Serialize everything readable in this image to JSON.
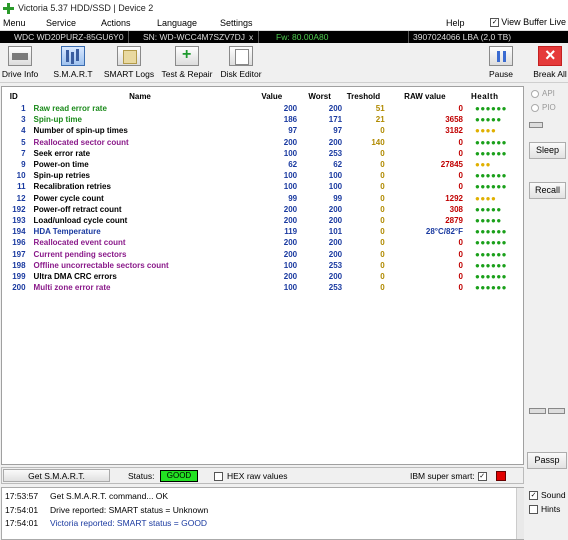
{
  "window": {
    "title": "Victoria 5.37 HDD/SSD | Device 2"
  },
  "menu": {
    "items": [
      "Menu",
      "Service",
      "Actions",
      "Language",
      "Settings",
      "Help"
    ],
    "view_buffer_label": "View Buffer Live",
    "view_buffer_checked": true
  },
  "device": {
    "model": "WDC WD20PURZ-85GU6Y0",
    "serial": "SN: WD-WCC4M7SZV7DJ",
    "close_glyph": "x",
    "firmware": "Fw: 80.00A80",
    "capacity": "3907024066 LBA (2,0 TB)"
  },
  "toolbar": {
    "drive_info": "Drive Info",
    "smart": "S.M.A.R.T",
    "smart_logs": "SMART Logs",
    "test_repair": "Test & Repair",
    "disk_editor": "Disk Editor",
    "pause": "Pause",
    "break_all": "Break All"
  },
  "table": {
    "headers": {
      "id": "ID",
      "name": "Name",
      "value": "Value",
      "worst": "Worst",
      "threshold": "Treshold",
      "raw": "RAW value",
      "health": "Health"
    },
    "rows": [
      {
        "id": "1",
        "name": "Raw read error rate",
        "value": "200",
        "worst": "200",
        "thr": "51",
        "raw": "0",
        "health": "●●●●●●",
        "color": "#1a8a1a",
        "raw_color": "#c00000",
        "thr_color": "#b08a00",
        "health_color": "#1aa01a"
      },
      {
        "id": "3",
        "name": "Spin-up time",
        "value": "186",
        "worst": "171",
        "thr": "21",
        "raw": "3658",
        "health": "●●●●●",
        "color": "#1a8a1a",
        "raw_color": "#c00000",
        "thr_color": "#b08a00",
        "health_color": "#1aa01a"
      },
      {
        "id": "4",
        "name": "Number of spin-up times",
        "value": "97",
        "worst": "97",
        "thr": "0",
        "raw": "3182",
        "health": "●●●●",
        "color": "#000000",
        "raw_color": "#c00000",
        "thr_color": "#b08a00",
        "health_color": "#e0b000"
      },
      {
        "id": "5",
        "name": "Reallocated sector count",
        "value": "200",
        "worst": "200",
        "thr": "140",
        "raw": "0",
        "health": "●●●●●●",
        "color": "#8a1a8a",
        "raw_color": "#c00000",
        "thr_color": "#b08a00",
        "health_color": "#1aa01a"
      },
      {
        "id": "7",
        "name": "Seek error rate",
        "value": "100",
        "worst": "253",
        "thr": "0",
        "raw": "0",
        "health": "●●●●●●",
        "color": "#000000",
        "raw_color": "#c00000",
        "thr_color": "#b08a00",
        "health_color": "#1aa01a"
      },
      {
        "id": "9",
        "name": "Power-on time",
        "value": "62",
        "worst": "62",
        "thr": "0",
        "raw": "27845",
        "health": "●●●",
        "color": "#000000",
        "raw_color": "#c00000",
        "thr_color": "#b08a00",
        "health_color": "#e0b000"
      },
      {
        "id": "10",
        "name": "Spin-up retries",
        "value": "100",
        "worst": "100",
        "thr": "0",
        "raw": "0",
        "health": "●●●●●●",
        "color": "#000000",
        "raw_color": "#c00000",
        "thr_color": "#b08a00",
        "health_color": "#1aa01a"
      },
      {
        "id": "11",
        "name": "Recalibration retries",
        "value": "100",
        "worst": "100",
        "thr": "0",
        "raw": "0",
        "health": "●●●●●●",
        "color": "#000000",
        "raw_color": "#c00000",
        "thr_color": "#b08a00",
        "health_color": "#1aa01a"
      },
      {
        "id": "12",
        "name": "Power cycle count",
        "value": "99",
        "worst": "99",
        "thr": "0",
        "raw": "1292",
        "health": "●●●●",
        "color": "#000000",
        "raw_color": "#c00000",
        "thr_color": "#b08a00",
        "health_color": "#e0b000"
      },
      {
        "id": "192",
        "name": "Power-off retract count",
        "value": "200",
        "worst": "200",
        "thr": "0",
        "raw": "308",
        "health": "●●●●●",
        "color": "#000000",
        "raw_color": "#c00000",
        "thr_color": "#b08a00",
        "health_color": "#1aa01a"
      },
      {
        "id": "193",
        "name": "Load/unload cycle count",
        "value": "200",
        "worst": "200",
        "thr": "0",
        "raw": "2879",
        "health": "●●●●●",
        "color": "#000000",
        "raw_color": "#c00000",
        "thr_color": "#b08a00",
        "health_color": "#1aa01a"
      },
      {
        "id": "194",
        "name": "HDA Temperature",
        "value": "119",
        "worst": "101",
        "thr": "0",
        "raw": "28°C/82°F",
        "health": "●●●●●●",
        "color": "#1a3aa0",
        "raw_color": "#1a3aa0",
        "thr_color": "#b08a00",
        "health_color": "#1aa01a"
      },
      {
        "id": "196",
        "name": "Reallocated event count",
        "value": "200",
        "worst": "200",
        "thr": "0",
        "raw": "0",
        "health": "●●●●●●",
        "color": "#8a1a8a",
        "raw_color": "#c00000",
        "thr_color": "#b08a00",
        "health_color": "#1aa01a"
      },
      {
        "id": "197",
        "name": "Current pending sectors",
        "value": "200",
        "worst": "200",
        "thr": "0",
        "raw": "0",
        "health": "●●●●●●",
        "color": "#8a1a8a",
        "raw_color": "#c00000",
        "thr_color": "#b08a00",
        "health_color": "#1aa01a"
      },
      {
        "id": "198",
        "name": "Offline uncorrectable sectors count",
        "value": "100",
        "worst": "253",
        "thr": "0",
        "raw": "0",
        "health": "●●●●●●",
        "color": "#8a1a8a",
        "raw_color": "#c00000",
        "thr_color": "#b08a00",
        "health_color": "#1aa01a"
      },
      {
        "id": "199",
        "name": "Ultra DMA CRC errors",
        "value": "200",
        "worst": "200",
        "thr": "0",
        "raw": "0",
        "health": "●●●●●●",
        "color": "#000000",
        "raw_color": "#c00000",
        "thr_color": "#b08a00",
        "health_color": "#1aa01a"
      },
      {
        "id": "200",
        "name": "Multi zone error rate",
        "value": "100",
        "worst": "253",
        "thr": "0",
        "raw": "0",
        "health": "●●●●●●",
        "color": "#8a1a8a",
        "raw_color": "#c00000",
        "thr_color": "#b08a00",
        "health_color": "#1aa01a"
      }
    ]
  },
  "right_panel": {
    "api": "API",
    "pio": "PIO",
    "sleep": "Sleep",
    "recall": "Recall",
    "passp": "Passp"
  },
  "status": {
    "get_smart": "Get S.M.A.R.T.",
    "status_label": "Status:",
    "status_value": "GOOD",
    "hex_raw": "HEX raw values",
    "ibm_label": "IBM super smart:",
    "ibm_checked": true
  },
  "log": [
    {
      "time": "17:53:57",
      "text": "Get S.M.A.R.T. command... OK",
      "color": "#000000"
    },
    {
      "time": "17:54:01",
      "text": "Drive reported: SMART status = Unknown",
      "color": "#000000"
    },
    {
      "time": "17:54:01",
      "text": "Victoria reported: SMART status = GOOD",
      "color": "#1a3aa0"
    }
  ],
  "sound": {
    "label": "Sound",
    "checked": true,
    "hints_label": "Hints"
  }
}
